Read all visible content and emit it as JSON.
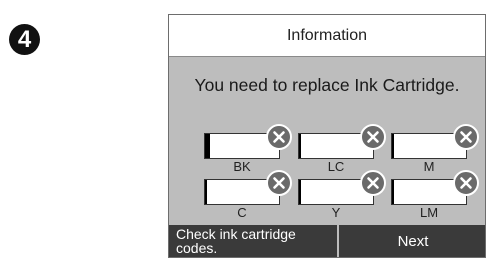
{
  "step": {
    "number": "4"
  },
  "dialog": {
    "title": "Information",
    "message": "You need to replace Ink Cartridge."
  },
  "cartridges": [
    {
      "label": "BK",
      "level": 0.07,
      "needs_replacement": true,
      "icon": "x-circle-icon"
    },
    {
      "label": "LC",
      "level": 0.02,
      "needs_replacement": true,
      "icon": "x-circle-icon"
    },
    {
      "label": "M",
      "level": 0.02,
      "needs_replacement": true,
      "icon": "x-circle-icon"
    },
    {
      "label": "C",
      "level": 0.02,
      "needs_replacement": true,
      "icon": "x-circle-icon"
    },
    {
      "label": "Y",
      "level": 0.02,
      "needs_replacement": true,
      "icon": "x-circle-icon"
    },
    {
      "label": "LM",
      "level": 0.02,
      "needs_replacement": true,
      "icon": "x-circle-icon"
    }
  ],
  "buttons": {
    "check_line1": "Check ink cartridge",
    "check_line2": "codes.",
    "next": "Next"
  },
  "colors": {
    "panel": "#bdbdbd",
    "button": "#3a3a3a",
    "x_icon": "#6a6a6a"
  }
}
